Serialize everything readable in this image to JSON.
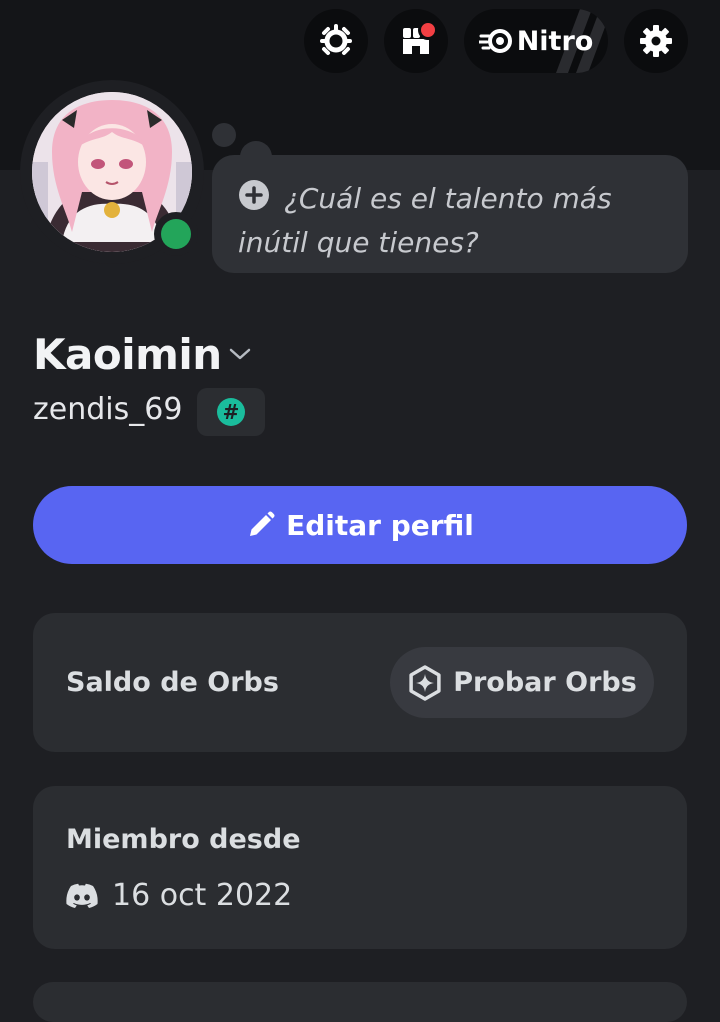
{
  "header": {
    "quests_icon": "laurel-wreath-icon",
    "shop_icon": "shop-icon",
    "shop_has_notification": true,
    "nitro_label": "Nitro",
    "settings_icon": "gear-icon"
  },
  "profile": {
    "status": "online",
    "status_color": "#23a55a",
    "custom_status_placeholder": "¿Cuál es el talento más inútil que tienes?",
    "display_name": "Kaoimin",
    "username": "zendis_69",
    "tag_badge": "#"
  },
  "actions": {
    "edit_profile_label": "Editar perfil",
    "accent_color": "#5865f2"
  },
  "orbs": {
    "label": "Saldo de Orbs",
    "button_label": "Probar Orbs"
  },
  "member": {
    "title": "Miembro desde",
    "date": "16 oct 2022"
  }
}
